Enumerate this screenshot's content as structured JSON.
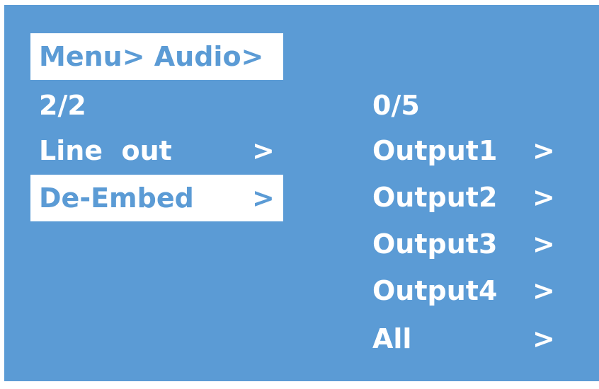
{
  "breadcrumb": {
    "text": "Menu> Audio>"
  },
  "left_panel": {
    "page_indicator": "2/2",
    "items": [
      {
        "label": "Line  out",
        "arrow": ">"
      },
      {
        "label": "De-Embed",
        "arrow": ">",
        "selected": true
      }
    ]
  },
  "right_panel": {
    "page_indicator": "0/5",
    "items": [
      {
        "label": "Output1",
        "arrow": ">"
      },
      {
        "label": "Output2",
        "arrow": ">"
      },
      {
        "label": "Output3",
        "arrow": ">"
      },
      {
        "label": "Output4",
        "arrow": ">"
      },
      {
        "label": "All",
        "arrow": ">"
      }
    ]
  },
  "colors": {
    "background": "#5b9bd5",
    "text": "#ffffff",
    "highlight": "#ffffff"
  }
}
